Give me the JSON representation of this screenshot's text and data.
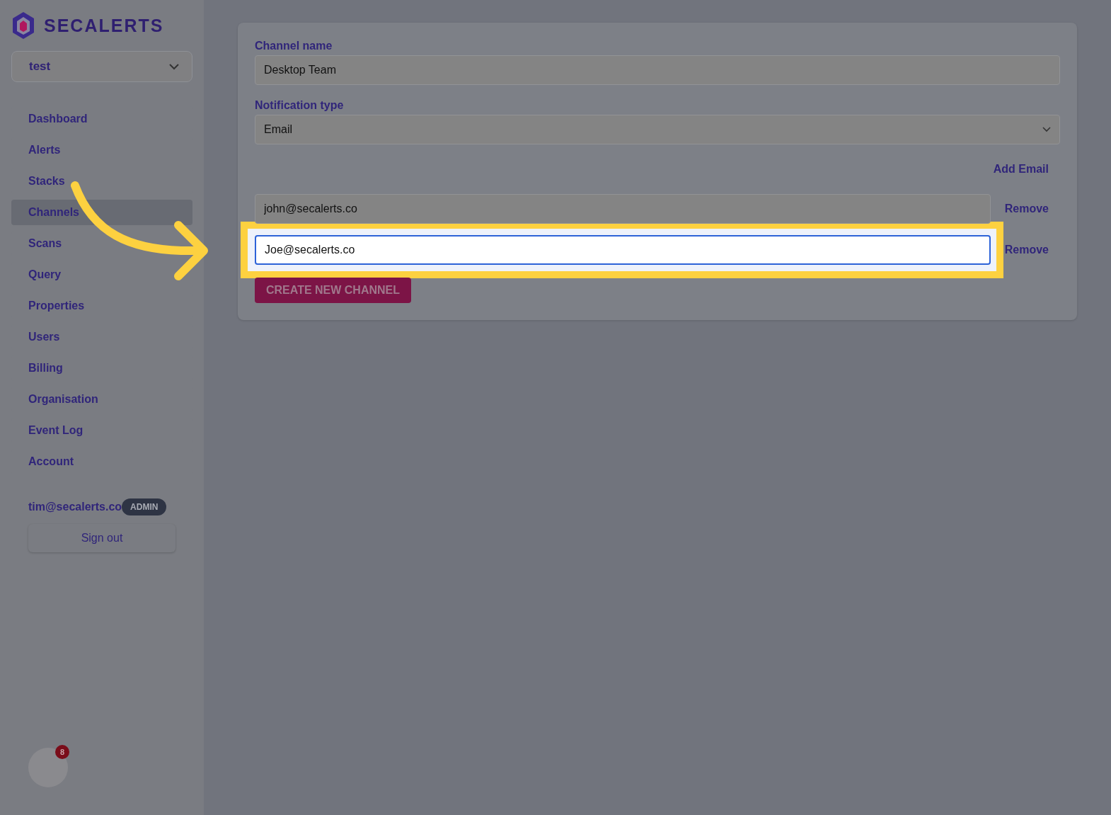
{
  "brand": {
    "name": "SECALERTS"
  },
  "org_select": {
    "value": "test"
  },
  "nav": [
    {
      "label": "Dashboard",
      "selected": false
    },
    {
      "label": "Alerts",
      "selected": false
    },
    {
      "label": "Stacks",
      "selected": false
    },
    {
      "label": "Channels",
      "selected": true
    },
    {
      "label": "Scans",
      "selected": false
    },
    {
      "label": "Query",
      "selected": false
    },
    {
      "label": "Properties",
      "selected": false
    },
    {
      "label": "Users",
      "selected": false
    },
    {
      "label": "Billing",
      "selected": false
    },
    {
      "label": "Organisation",
      "selected": false
    },
    {
      "label": "Event Log",
      "selected": false
    },
    {
      "label": "Account",
      "selected": false
    }
  ],
  "user": {
    "email": "tim@secalerts.co",
    "role": "ADMIN"
  },
  "sign_out": "Sign out",
  "chat_widget": {
    "badge": "8"
  },
  "form": {
    "channel_name_label": "Channel name",
    "channel_name": "Desktop Team",
    "notification_type_label": "Notification type",
    "notification_type": "Email",
    "add_email": "Add Email",
    "emails": [
      {
        "value": "john@secalerts.co",
        "remove": "Remove",
        "highlighted": false
      },
      {
        "value": "Joe@secalerts.co",
        "remove": "Remove",
        "highlighted": true
      }
    ],
    "submit": "CREATE NEW CHANNEL"
  }
}
